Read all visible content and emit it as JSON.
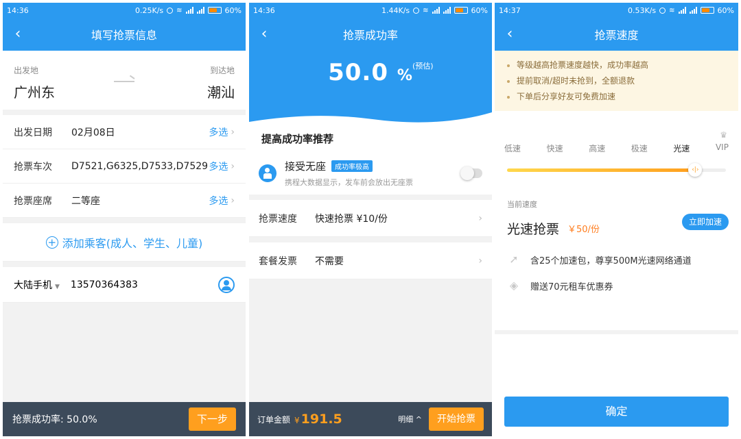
{
  "screens": {
    "fill_info": {
      "status": {
        "time": "14:36",
        "speed": "0.25K/s",
        "battery": "60%"
      },
      "title": "填写抢票信息",
      "from_label": "出发地",
      "to_label": "到达地",
      "from_city": "广州东",
      "to_city": "潮汕",
      "fields": [
        {
          "label": "出发日期",
          "value": "02月08日",
          "action": "多选"
        },
        {
          "label": "抢票车次",
          "value": "D7521,G6325,D7533,D7529",
          "action": "多选"
        },
        {
          "label": "抢票座席",
          "value": "二等座",
          "action": "多选"
        }
      ],
      "add_passenger": "添加乘客(成人、学生、儿童)",
      "phone_region": "大陆手机",
      "phone_number": "13570364383",
      "success_rate_text": "抢票成功率: 50.0%",
      "next_button": "下一步"
    },
    "success_rate": {
      "status": {
        "time": "14:36",
        "speed": "1.44K/s",
        "battery": "60%"
      },
      "title": "抢票成功率",
      "rate_value": "50.0",
      "rate_unit": "%",
      "estimate_note": "(预估)",
      "recommend_title": "提高成功率推荐",
      "no_seat": {
        "title": "接受无座",
        "badge": "成功率极高",
        "desc": "携程大数据显示，发车前会放出无座票",
        "enabled": false
      },
      "options": [
        {
          "label": "抢票速度",
          "value": "快速抢票 ¥10/份"
        },
        {
          "label": "套餐发票",
          "value": "不需要"
        }
      ],
      "order_label": "订单金额",
      "currency": "¥",
      "amount": "191.5",
      "detail_label": "明细 ^",
      "start_button": "开始抢票"
    },
    "speed": {
      "status": {
        "time": "14:37",
        "speed": "0.53K/s",
        "battery": "60%"
      },
      "title": "抢票速度",
      "notices": [
        "等级越高抢票速度越快，成功率越高",
        "提前取消/超时未抢到，全额退款",
        "下单后分享好友可免费加速"
      ],
      "levels": [
        "低速",
        "快速",
        "高速",
        "极速",
        "光速",
        "VIP"
      ],
      "selected_level_index": 4,
      "slider_fraction": 0.86,
      "current_label": "当前速度",
      "current_name": "光速抢票",
      "current_price": "￥50/份",
      "speedup_button": "立即加速",
      "perks": [
        {
          "icon": "rocket-icon",
          "text": "含25个加速包，尊享500M光速网络通道"
        },
        {
          "icon": "coupon-icon",
          "text": "赠送70元租车优惠券"
        }
      ],
      "confirm_button": "确定"
    }
  },
  "colors": {
    "primary": "#2b9af0",
    "accent": "#ff9f1e",
    "bar_dark": "#3c4a5a"
  }
}
